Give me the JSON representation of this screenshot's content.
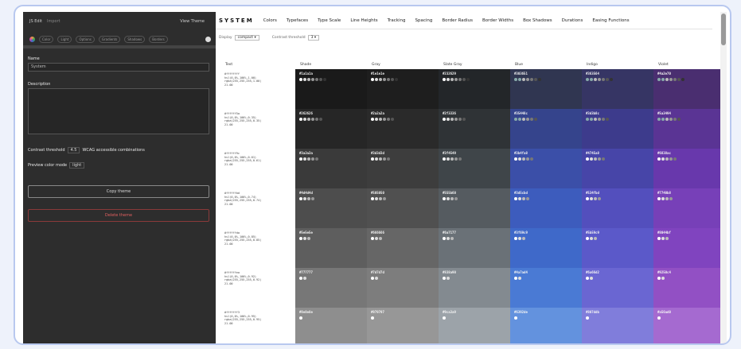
{
  "panel": {
    "top_left": "JS Edit",
    "top_center": "Import",
    "top_right": "View Theme",
    "tools": [
      "Color",
      "Light",
      "Options",
      "Gradients",
      "Shadows",
      "Borders"
    ],
    "name_label": "Name",
    "name_value": "System",
    "description_label": "Description",
    "description_value": "",
    "contrast_label": "Contrast threshold",
    "contrast_value": "4.5",
    "contrast_note": "WCAG accessible combinations",
    "preview_label": "Preview color mode",
    "preview_value": "light",
    "copy_button": "Copy theme",
    "delete_button": "Delete theme"
  },
  "main": {
    "brand": "SYSTEM",
    "nav": [
      "Colors",
      "Typefaces",
      "Type Scale",
      "Line Heights",
      "Tracking",
      "Spacing",
      "Border Radius",
      "Border Widths",
      "Box Shadows",
      "Durations",
      "Easing Functions"
    ],
    "display_label": "Display",
    "display_value": "compact",
    "contrast_threshold_label": "Contrast threshold",
    "contrast_threshold_value": "3",
    "headers": [
      "Text",
      "Shade",
      "Gray",
      "Slate Gray",
      "Blue",
      "Indigo",
      "Violet"
    ],
    "rows": [
      {
        "tone": 0,
        "lines": [
          "#ffffffff",
          "hsl(0,0%,100%,1.00)",
          "rgba(255,255,255,1.00)",
          "21.00"
        ],
        "cols": [
          "#1a1a1a",
          "#1e1e1e",
          "#232629",
          "#303651",
          "#363564",
          "#4a2e70"
        ]
      },
      {
        "tone": 1,
        "lines": [
          "#ffffff5a",
          "hsl(0,0%,100%,0.35)",
          "rgba(255,255,255,0.35)",
          "21.00"
        ],
        "cols": [
          "#262626",
          "#2a2a2a",
          "#2f3336",
          "#35448c",
          "#3d3b8c",
          "#5a3494"
        ]
      },
      {
        "tone": 2,
        "lines": [
          "#ffffff9c",
          "hsl(0,0%,100%,0.61)",
          "rgba(255,255,255,0.61)",
          "21.00"
        ],
        "cols": [
          "#3a3a3a",
          "#3d3d3d",
          "#3f4549",
          "#3b4fa8",
          "#4745a8",
          "#6838ac"
        ]
      },
      {
        "tone": 3,
        "lines": [
          "#ffffffbd",
          "hsl(0,0%,100%,0.74)",
          "rgba(255,255,255,0.74)",
          "21.00"
        ],
        "cols": [
          "#4d4d4d",
          "#505050",
          "#555b60",
          "#3d5cbd",
          "#534fbd",
          "#7740b8"
        ]
      },
      {
        "tone": 4,
        "lines": [
          "#ffffffda",
          "hsl(0,0%,100%,0.85)",
          "rgba(255,255,255,0.85)",
          "21.00"
        ],
        "cols": [
          "#5e5e5e",
          "#666666",
          "#6a7177",
          "#3f69c9",
          "#5b59c9",
          "#8044bf"
        ]
      },
      {
        "tone": 5,
        "lines": [
          "#ffffffea",
          "hsl(0,0%,100%,0.92)",
          "rgba(255,255,255,0.92)",
          "21.00"
        ],
        "cols": [
          "#777777",
          "#7d7d7d",
          "#838a90",
          "#4a7ad4",
          "#6a66d2",
          "#9250c4"
        ]
      },
      {
        "tone": 6,
        "lines": [
          "#fffffff3",
          "hsl(0,0%,100%,0.95)",
          "rgba(255,255,255,0.95)",
          "21.00"
        ],
        "cols": [
          "#8e8e8e",
          "#979797",
          "#9ca3a9",
          "#6392de",
          "#807ddb",
          "#a56ad0"
        ]
      }
    ]
  }
}
